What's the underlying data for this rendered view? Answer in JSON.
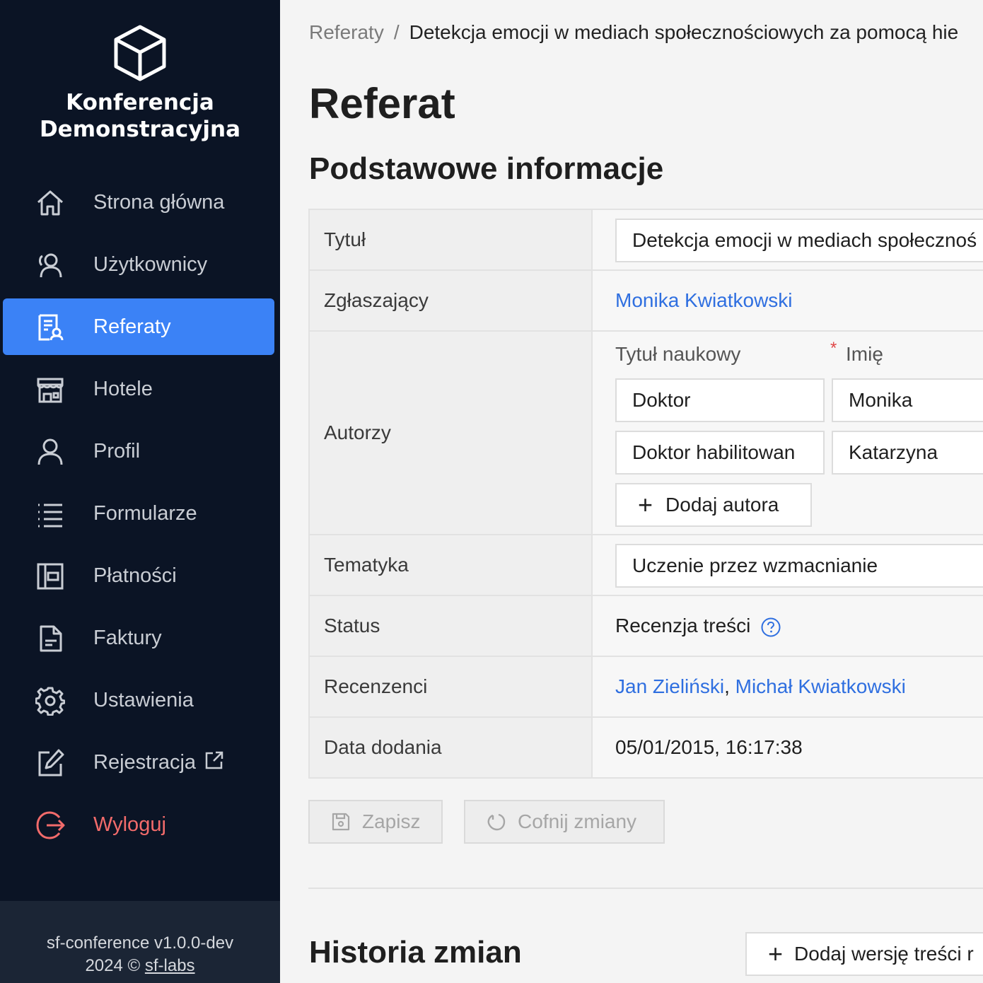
{
  "app": {
    "brand_line1": "Konferencja",
    "brand_line2": "Demonstracyjna",
    "version": "sf-conference v1.0.0-dev",
    "copyright": "2024 ©",
    "company_link": "sf-labs"
  },
  "nav": {
    "home": "Strona główna",
    "users": "Użytkownicy",
    "papers": "Referaty",
    "hotels": "Hotele",
    "profile": "Profil",
    "forms": "Formularze",
    "payments": "Płatności",
    "invoices": "Faktury",
    "settings": "Ustawienia",
    "registration": "Rejestracja",
    "logout": "Wyloguj"
  },
  "breadcrumb": {
    "parent": "Referaty",
    "separator": "/",
    "current": "Detekcja emocji w mediach społecznościowych za pomocą hie"
  },
  "page": {
    "title": "Referat",
    "section_basic": "Podstawowe informacje",
    "section_history": "Historia zmian"
  },
  "form": {
    "title_label": "Tytuł",
    "title_value": "Detekcja emocji w mediach społecznoś",
    "submitter_label": "Zgłaszający",
    "submitter_value": "Monika Kwiatkowski",
    "authors_label": "Autorzy",
    "authors_col_degree": "Tytuł naukowy",
    "authors_col_name": "Imię",
    "required_mark": "*",
    "authors": [
      {
        "degree": "Doktor",
        "name": "Monika"
      },
      {
        "degree": "Doktor habilitowan",
        "name": "Katarzyna"
      }
    ],
    "add_author": "Dodaj autora",
    "topic_label": "Tematyka",
    "topic_value": "Uczenie przez wzmacnianie",
    "status_label": "Status",
    "status_value": "Recenzja treści",
    "reviewers_label": "Recenzenci",
    "reviewer_1": "Jan Zieliński",
    "reviewer_sep": ",",
    "reviewer_2": "Michał Kwiatkowski",
    "date_label": "Data dodania",
    "date_value": "05/01/2015, 16:17:38"
  },
  "actions": {
    "save": "Zapisz",
    "revert": "Cofnij zmiany",
    "add_version": "Dodaj wersję treści r"
  },
  "colors": {
    "sidebar_bg": "#0b1425",
    "active": "#3b82f6",
    "link": "#2f6fe0",
    "logout": "#f26b6b"
  }
}
